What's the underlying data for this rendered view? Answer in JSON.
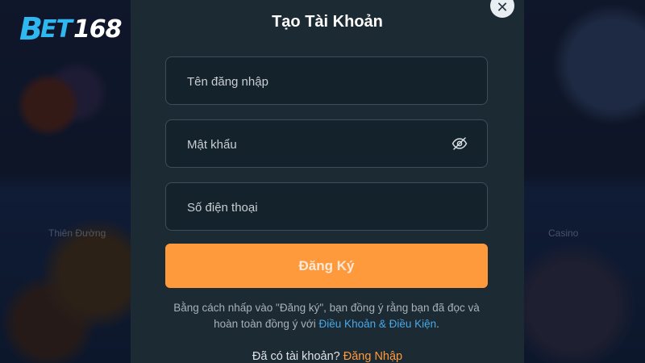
{
  "brand": {
    "logo_prefix": "B",
    "logo_mid": "ET",
    "logo_num": "168"
  },
  "background": {
    "card_label_left": "Thiên Đường",
    "card_label_right": "Casino"
  },
  "modal": {
    "title": "Tạo Tài Khoản",
    "close_icon": "close-icon",
    "fields": {
      "username_placeholder": "Tên đăng nhập",
      "password_placeholder": "Mật khẩu",
      "phone_placeholder": "Số điện thoại"
    },
    "password_toggle_icon": "eye-slash-icon",
    "submit_label": "Đăng Ký",
    "terms_prefix": "Bằng cách nhấp vào \"Đăng ký\", bạn đồng ý rằng bạn đã đọc và hoàn toàn đồng ý với ",
    "terms_link": "Điều Khoản & Điều Kiện",
    "terms_suffix": ".",
    "login_prompt": "Đã có tài khoản? ",
    "login_link": "Đăng Nhập"
  },
  "colors": {
    "modal_bg": "#1b2a33",
    "field_border": "#39505c",
    "accent_orange": "#ff9a3c",
    "link_blue": "#4aa8e8",
    "logo_blue": "#2fb8f0"
  }
}
